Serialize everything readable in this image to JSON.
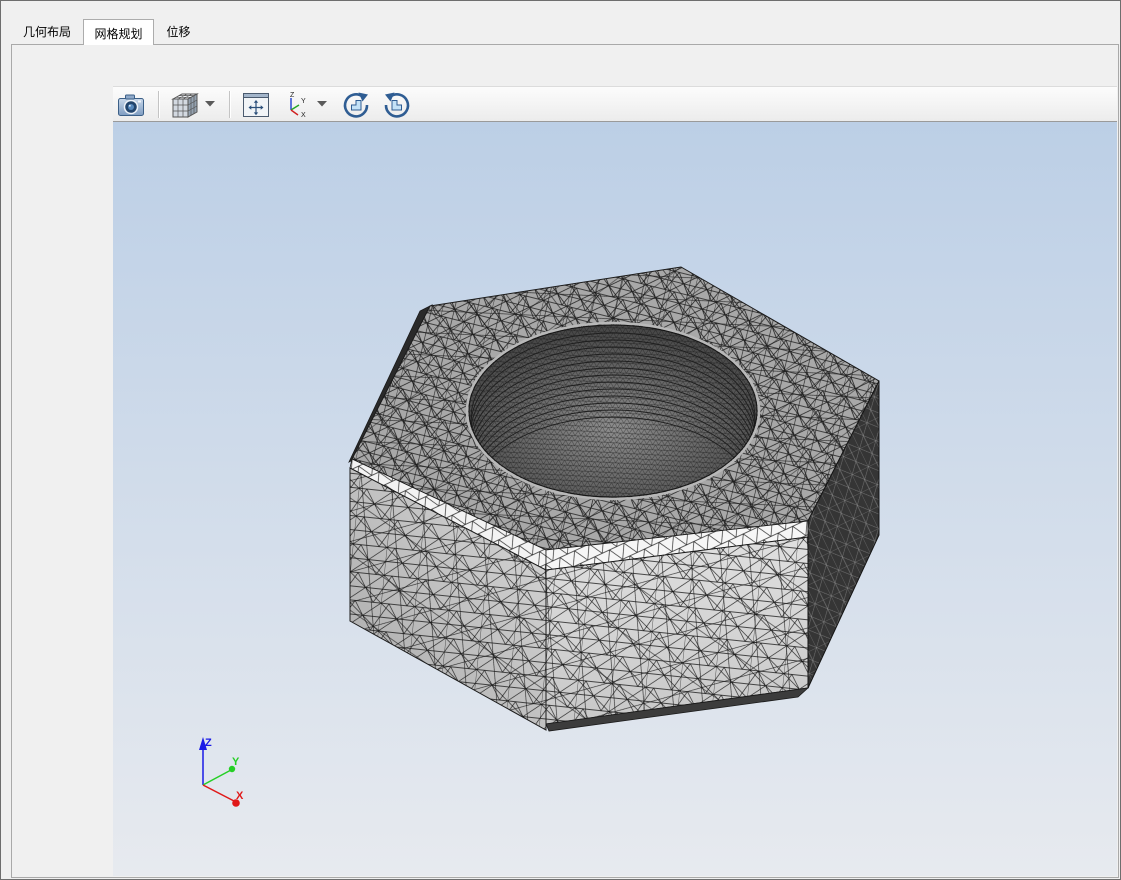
{
  "tabs": [
    {
      "label": "几何布局"
    },
    {
      "label": "网格规划"
    },
    {
      "label": "位移"
    }
  ],
  "active_tab_index": 1,
  "toolbar": {
    "buttons": [
      {
        "icon": "camera-icon"
      },
      {
        "icon": "view-cube-icon",
        "has_dropdown": true
      },
      {
        "icon": "fit-view-icon"
      },
      {
        "icon": "axis-orientation-icon",
        "has_dropdown": true
      },
      {
        "icon": "rotate-clockwise-icon"
      },
      {
        "icon": "rotate-counterclockwise-icon"
      }
    ]
  },
  "axis_triad": {
    "z": "Z",
    "y": "Y",
    "x": "X"
  },
  "colors": {
    "viewport_top": "#bccfe6",
    "viewport_bottom": "#e7eaef",
    "axis_x": "#e01818",
    "axis_y": "#25cf25",
    "axis_z": "#1a1ae6",
    "active_tab_bg": "#ffffff"
  }
}
